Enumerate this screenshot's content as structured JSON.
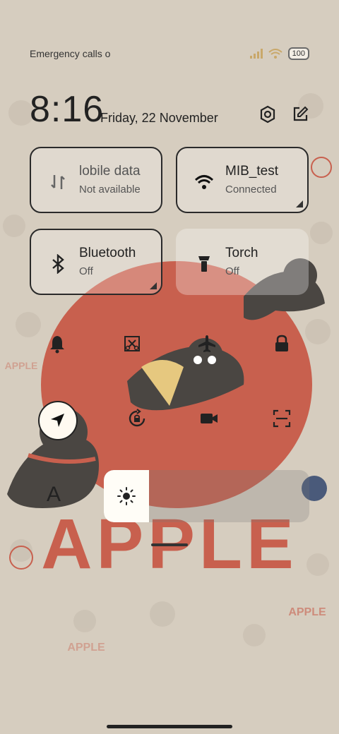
{
  "status_bar": {
    "left_text": "Emergency calls o",
    "battery": "100"
  },
  "header": {
    "time": "8:16",
    "date": "Friday, 22 November"
  },
  "tiles": {
    "mobile_data": {
      "title": "lobile data",
      "subtitle": "Not available"
    },
    "wifi": {
      "title": "MIB_test",
      "subtitle": "Connected"
    },
    "bluetooth": {
      "title": "Bluetooth",
      "subtitle": "Off"
    },
    "torch": {
      "title": "Torch",
      "subtitle": "Off"
    }
  },
  "font_size_label": "A",
  "wallpaper": {
    "text": "APPLE",
    "small_text_1": "APPLE",
    "small_text_2": "APPLE",
    "small_text_3": "APPLE"
  },
  "colors": {
    "apple_red": "#c8604e",
    "cat": "#4a4642",
    "ribbon": "#e6c87f",
    "background": "#d6cdbf"
  }
}
